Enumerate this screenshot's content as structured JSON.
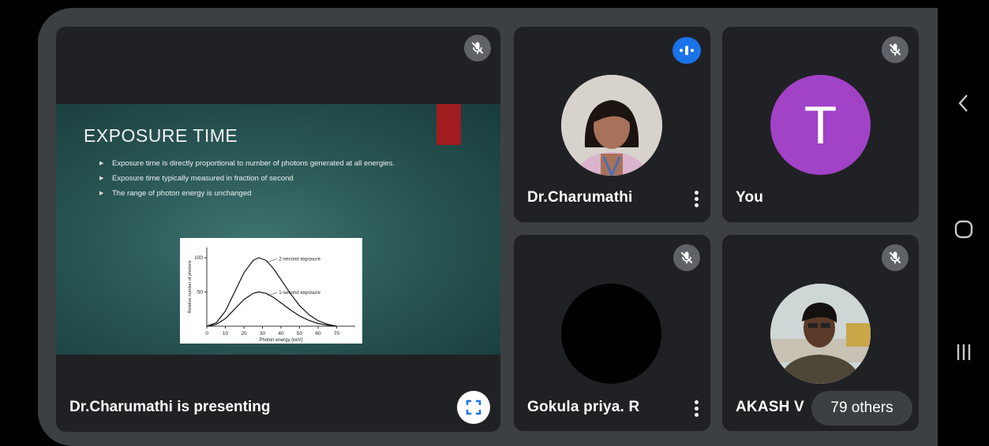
{
  "presentation": {
    "slide_title": "EXPOSURE TIME",
    "bullets": [
      "Exposure time is directly proportional to number of photons generated at all energies.",
      "Exposure time typically measured in fraction of second",
      "The range of photon energy is unchanged"
    ],
    "presenting_label": "Dr.Charumathi is presenting"
  },
  "slide_chart": {
    "type": "line",
    "xlabel": "Photon energy (keV)",
    "ylabel": "Relative number of photons",
    "x_ticks": [
      "0",
      "10",
      "20",
      "30",
      "40",
      "50",
      "60",
      "70"
    ],
    "y_ticks": [
      "50",
      "100"
    ],
    "xlim": [
      0,
      80
    ],
    "ylim": [
      0,
      115
    ],
    "series": [
      {
        "name": "2-second exposure",
        "x": [
          0,
          5,
          10,
          15,
          20,
          25,
          28,
          32,
          36,
          40,
          45,
          50,
          55,
          60,
          65,
          70
        ],
        "y": [
          0,
          5,
          22,
          50,
          78,
          96,
          100,
          96,
          84,
          68,
          48,
          30,
          17,
          8,
          3,
          0
        ]
      },
      {
        "name": "1-second exposure",
        "x": [
          0,
          5,
          10,
          15,
          20,
          25,
          28,
          32,
          36,
          40,
          45,
          50,
          55,
          60,
          65,
          70
        ],
        "y": [
          0,
          2.5,
          11,
          25,
          39,
          48,
          50,
          48,
          42,
          34,
          24,
          15,
          8.5,
          4,
          1.5,
          0
        ]
      }
    ]
  },
  "participants": [
    {
      "name": "Dr.Charumathi",
      "state": "speaking"
    },
    {
      "name": "You",
      "initial": "T",
      "avatar_color": "#a142c7",
      "state": "muted"
    },
    {
      "name": "Gokula priya. R",
      "state": "muted"
    },
    {
      "name": "AKASH V",
      "state": "muted"
    }
  ],
  "others_label": "79 others",
  "colors": {
    "tile_bg": "#202124",
    "frame_bg": "#3c4043",
    "speaking": "#1a73e8",
    "muted_badge": "#5f6368"
  },
  "nav": {
    "back_icon": "back-icon",
    "home_icon": "home-icon",
    "recents_icon": "recents-icon"
  }
}
